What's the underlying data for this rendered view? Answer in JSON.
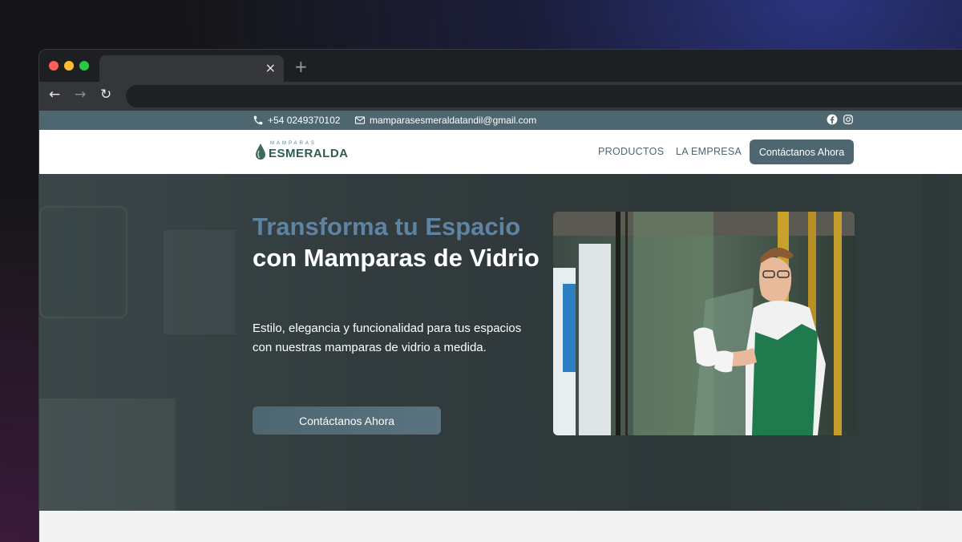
{
  "browser": {
    "tab_close": "×",
    "new_tab": "+",
    "back": "←",
    "forward": "→",
    "reload": "↻"
  },
  "topbar": {
    "phone": "+54 0249370102",
    "email": "mamparasesmeraldatandil@gmail.com",
    "social_icons": [
      "facebook-icon",
      "instagram-icon"
    ]
  },
  "header": {
    "logo_top": "MAMPARAS",
    "logo_main": "ESMERALDA",
    "nav": [
      "PRODUCTOS",
      "LA EMPRESA"
    ],
    "cta": "Contáctanos Ahora"
  },
  "hero": {
    "title_accent": "Transforma tu Espacio",
    "title_rest_1": "con",
    "title_rest_2": "Mamparas de Vidrio",
    "subtitle": "Estilo, elegancia y funcionalidad para tus espacios con nuestras mamparas de vidrio a medida.",
    "cta": "Contáctanos Ahora"
  },
  "colors": {
    "brand": "#4e6670",
    "accent_text": "#5f84a3",
    "hero_bg": "#323c3e",
    "worker_apron": "#1f7a4e"
  }
}
